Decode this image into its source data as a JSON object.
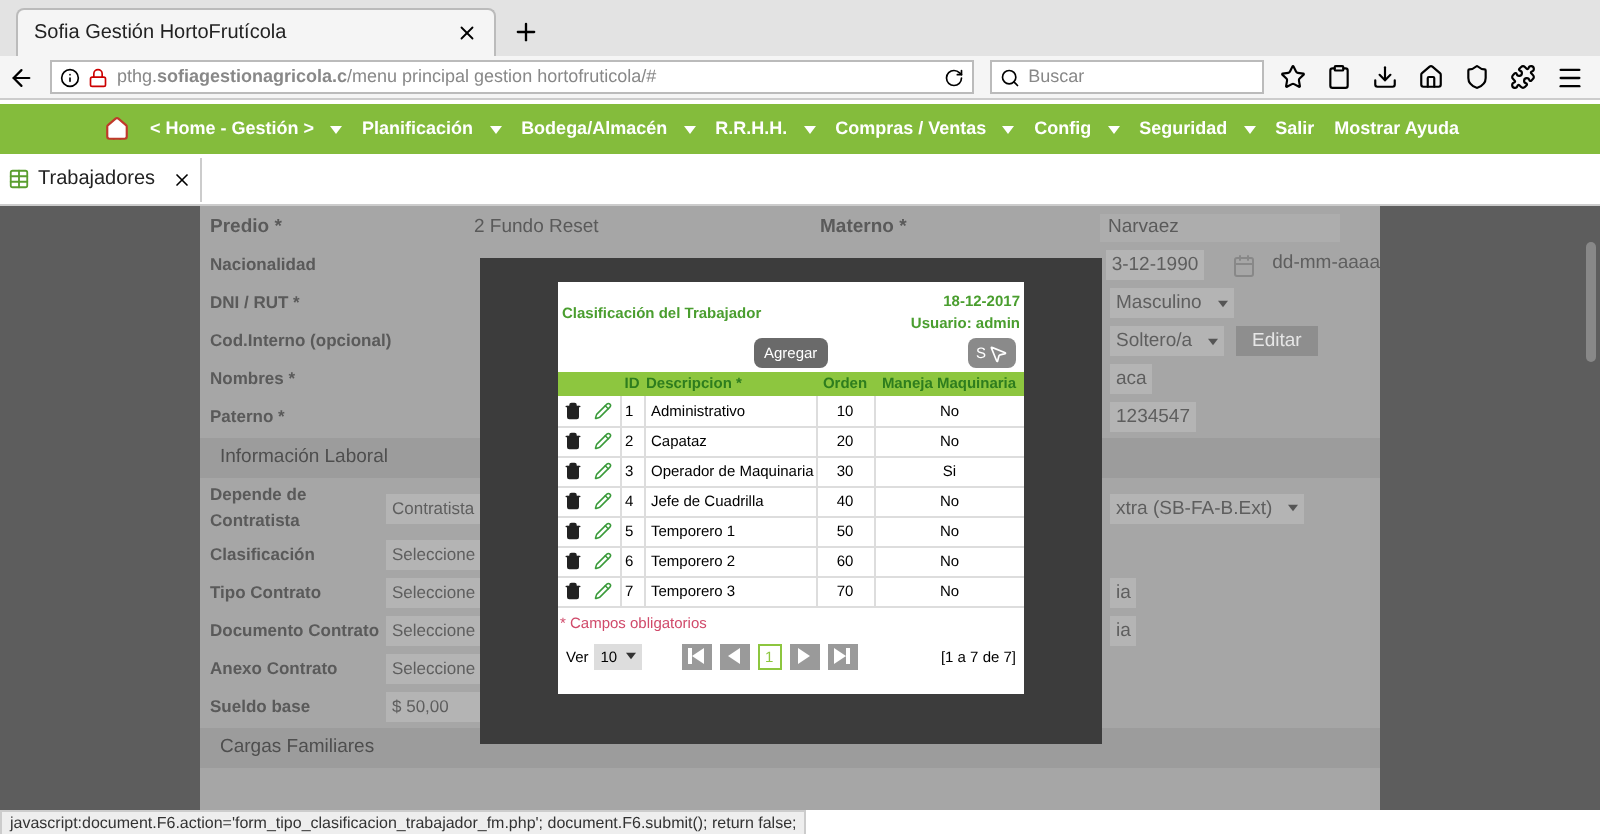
{
  "browser": {
    "tab_title": "Sofia Gestión HortoFrutícola",
    "url": "pthg.**sofiagestionagricola.c**/menu principal gestion hortofruticola/#",
    "search_placeholder": "Buscar"
  },
  "nav": [
    {
      "label": "< Home - Gestión >",
      "has_menu": true
    },
    {
      "label": "Planificación",
      "has_menu": true
    },
    {
      "label": "Bodega/Almacén",
      "has_menu": true
    },
    {
      "label": "R.R.H.H.",
      "has_menu": true
    },
    {
      "label": "Compras / Ventas",
      "has_menu": true
    },
    {
      "label": "Config",
      "has_menu": true
    },
    {
      "label": "Seguridad",
      "has_menu": true
    },
    {
      "label": "Salir",
      "has_menu": false
    },
    {
      "label": "Mostrar Ayuda",
      "has_menu": false
    }
  ],
  "page_tab": {
    "label": "Trabajadores"
  },
  "form": {
    "top": {
      "label": "Predio *",
      "value": "2 Fundo Reset",
      "center_label": "Materno *",
      "right_value": "Narvaez"
    },
    "rows": [
      {
        "kind": "field",
        "label": "Nacionalidad",
        "right_value": "3-12-1990",
        "right_extra": {
          "kind": "date_hint",
          "text": "dd-mm-aaaa"
        }
      },
      {
        "kind": "field",
        "label": "DNI / RUT *",
        "right_value": "Masculino",
        "right_select": true
      },
      {
        "kind": "field",
        "label": "Cod.Interno (opcional)",
        "right_value": "Soltero/a",
        "right_select": true,
        "right_extra": {
          "kind": "button",
          "text": "Editar"
        }
      },
      {
        "kind": "field",
        "label": "Nombres *",
        "right_value": "aca"
      },
      {
        "kind": "field",
        "label": "Paterno *",
        "right_value": "1234547"
      },
      {
        "kind": "section",
        "label": "Información Laboral"
      },
      {
        "kind": "field",
        "label": "Depende de Contratista",
        "value": "Contratista",
        "right_value": "xtra (SB-FA-B.Ext)",
        "right_select": true
      },
      {
        "kind": "field",
        "label": "Clasificación",
        "value": "Seleccione"
      },
      {
        "kind": "field",
        "label": "Tipo Contrato",
        "value": "Seleccione",
        "right_value": "ia"
      },
      {
        "kind": "field",
        "label": "Documento Contrato",
        "value": "Seleccione",
        "right_value": "ia"
      },
      {
        "kind": "field",
        "label": "Anexo Contrato",
        "value": "Seleccione"
      },
      {
        "kind": "field",
        "label": "Sueldo base",
        "value": "$ 50,00"
      },
      {
        "kind": "section",
        "label": "Cargas Familiares"
      }
    ]
  },
  "modal": {
    "title": "Clasificación del Trabajador",
    "date": "18-12-2017",
    "user": "Usuario: admin",
    "add_button": "Agregar",
    "exit_button": "S",
    "columns": [
      "ID",
      "Descripcion *",
      "Orden",
      "Maneja Maquinaria"
    ],
    "rows": [
      {
        "id": "1",
        "descripcion": "Administrativo",
        "orden": "10",
        "maneja": "No"
      },
      {
        "id": "2",
        "descripcion": "Capataz",
        "orden": "20",
        "maneja": "No"
      },
      {
        "id": "3",
        "descripcion": "Operador de Maquinaria",
        "orden": "30",
        "maneja": "Si"
      },
      {
        "id": "4",
        "descripcion": "Jefe de Cuadrilla",
        "orden": "40",
        "maneja": "No"
      },
      {
        "id": "5",
        "descripcion": "Temporero 1",
        "orden": "50",
        "maneja": "No"
      },
      {
        "id": "6",
        "descripcion": "Temporero 2",
        "orden": "60",
        "maneja": "No"
      },
      {
        "id": "7",
        "descripcion": "Temporero 3",
        "orden": "70",
        "maneja": "No"
      }
    ],
    "required_note": "* Campos obligatorios",
    "page_size_label": "Ver",
    "page_size": "10",
    "current_page": "1",
    "range": "[1 a 7 de 7]"
  },
  "status_bar": "javascript:document.F6.action='form_tipo_clasificacion_trabajador_fm.php'; document.F6.submit(); return false;"
}
